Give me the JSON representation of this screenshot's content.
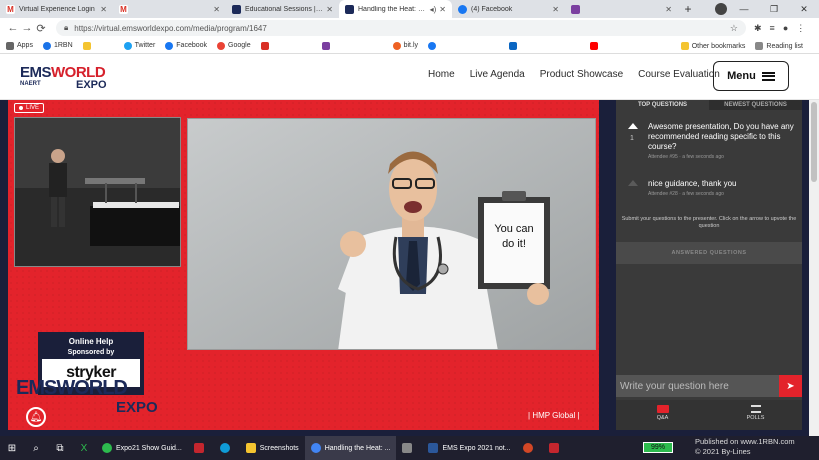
{
  "browser": {
    "tabs": [
      {
        "title": "Virtual Experience Login",
        "color": "#d93025",
        "glyph": "M"
      },
      {
        "title": "",
        "color": "#d93025",
        "glyph": "M"
      },
      {
        "title": "Educational Sessions | EMS",
        "color": "#1c2a59",
        "glyph": "⊕"
      },
      {
        "title": "Handling the Heat: Psy",
        "color": "#1c2a59",
        "glyph": "⊕"
      },
      {
        "title": "(4) Facebook",
        "color": "#1877f2",
        "glyph": "f"
      },
      {
        "title": "",
        "color": "#7b3fa0",
        "glyph": "✉"
      }
    ],
    "url": "https://virtual.emsworldexpo.com/media/program/1647",
    "bookmarks": [
      {
        "label": "Apps",
        "color": "#666"
      },
      {
        "label": "1RBN",
        "color": "#1a73e8"
      },
      {
        "label": "",
        "color": "#f4c430"
      },
      {
        "label": "Twitter",
        "color": "#1da1f2"
      },
      {
        "label": "Facebook",
        "color": "#1877f2"
      },
      {
        "label": "Google",
        "color": "#ea4335"
      },
      {
        "label": "",
        "color": "#d93025"
      },
      {
        "label": "",
        "color": "#7b3fa0"
      },
      {
        "label": "bit.ly",
        "color": "#ee6123"
      },
      {
        "label": "",
        "color": "#1877f2"
      },
      {
        "label": "",
        "color": "#0a66c2"
      },
      {
        "label": "",
        "color": "#ff0000"
      }
    ],
    "other_bookmarks": "Other bookmarks",
    "reading_list": "Reading list"
  },
  "site": {
    "logo_main": "EMS",
    "logo_accent": "WORLD",
    "logo_sub": "EXPO",
    "logo_tag": "NAERT",
    "nav": [
      "Home",
      "Live Agenda",
      "Product Showcase",
      "Course Evaluation"
    ],
    "menu_label": "Menu"
  },
  "stage": {
    "live_label": "LIVE",
    "clipboard_text": "You can do it!",
    "help_title": "Online Help",
    "help_sponsored": "Sponsored by",
    "sponsor": "stryker",
    "bottom_logo_main": "EMSWORLD",
    "bottom_logo_sub": "EXPO",
    "partner": "HMP Global",
    "colors": {
      "stage_red": "#e3232b",
      "navy": "#1c2a59"
    }
  },
  "questions": {
    "tabs": [
      "TOP QUESTIONS",
      "NEWEST QUESTIONS"
    ],
    "items": [
      {
        "text": "Awesome presentation, Do you have any recommended reading specific to this course?",
        "votes": "1",
        "meta": "Attendee #95 · a few seconds ago"
      },
      {
        "text": "nice guidance, thank you",
        "votes": "",
        "meta": "Attendee #28 · a few seconds ago"
      }
    ],
    "note": "Submit your questions to the presenter. Click on the arrow to upvote the question",
    "answered_label": "ANSWERED QUESTIONS",
    "input_placeholder": "Write your question here",
    "footer": [
      {
        "label": "Q&A",
        "icon": "chat-icon"
      },
      {
        "label": "POLLS",
        "icon": "list-icon"
      }
    ]
  },
  "taskbar": {
    "apps": [
      {
        "label": "Expo21 Show Guid...",
        "color": "#2dbb4e"
      },
      {
        "label": "",
        "color": "#c4262e"
      },
      {
        "label": "",
        "color": "#0f9bd7"
      },
      {
        "label": "Screenshots",
        "color": "#f4c430"
      },
      {
        "label": "Handling the Heat: ...",
        "color": "#4285f4"
      },
      {
        "label": "",
        "color": "#888"
      },
      {
        "label": "EMS Expo 2021 not...",
        "color": "#2b579a"
      },
      {
        "label": "",
        "color": "#d24726"
      },
      {
        "label": "",
        "color": "#c4262e"
      }
    ],
    "battery": "99%"
  },
  "watermark": {
    "line1": "Published on www.1RBN.com",
    "line2": "© 2021 By-Lines"
  }
}
